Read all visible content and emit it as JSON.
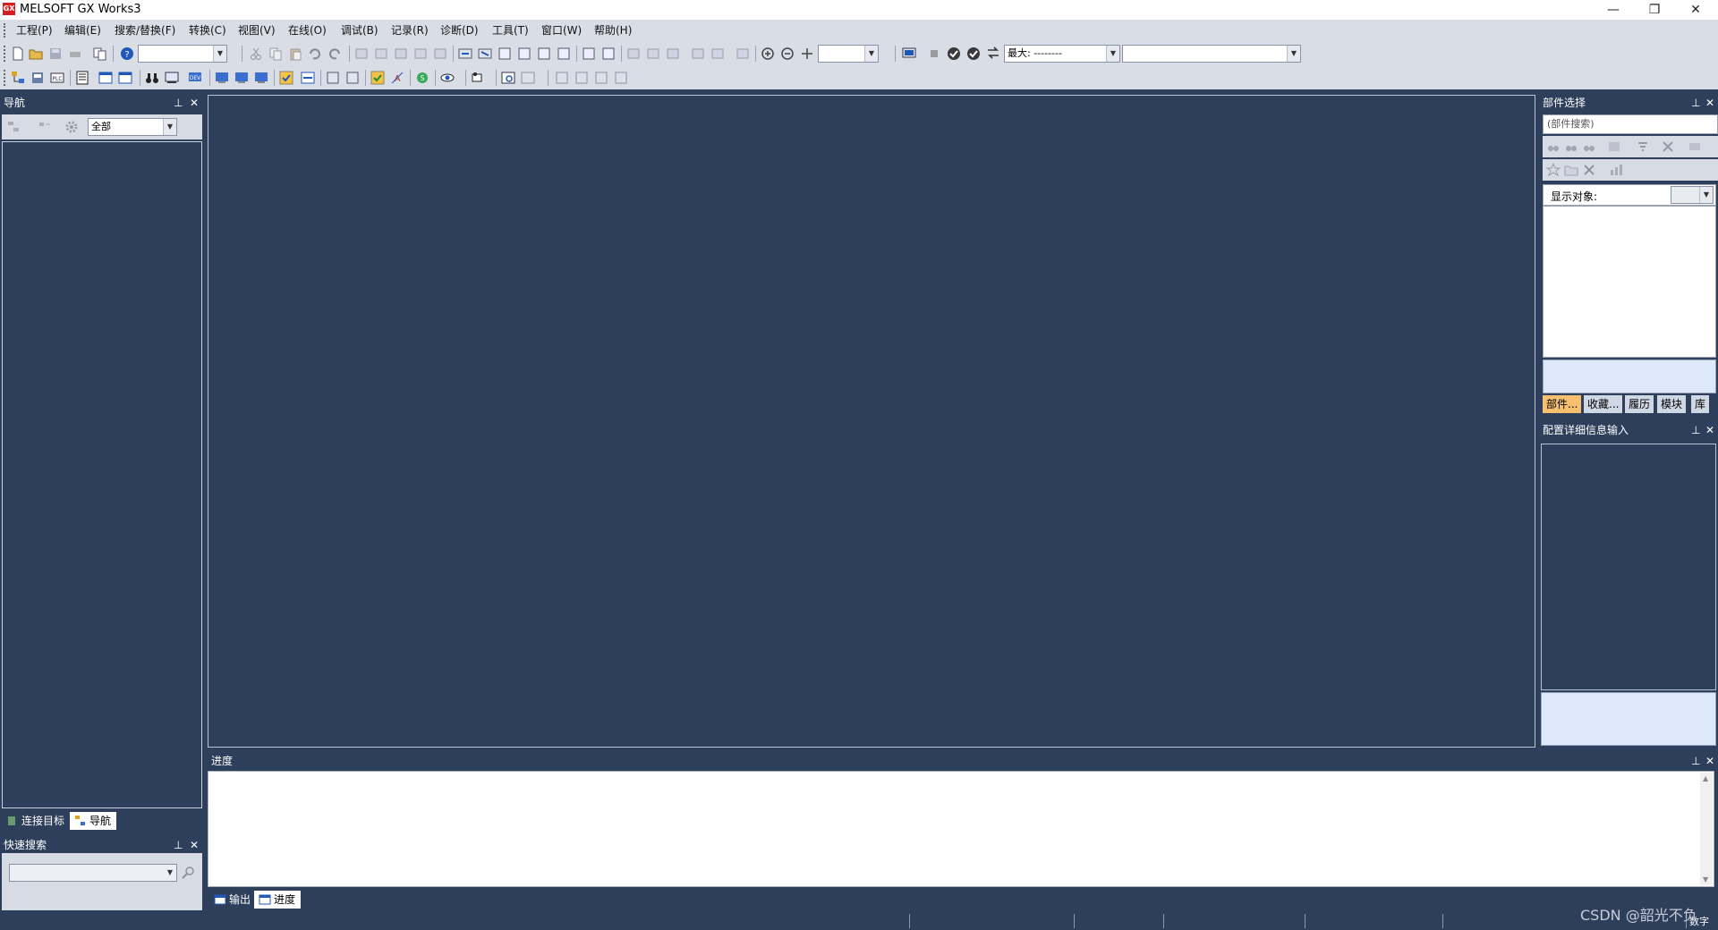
{
  "window": {
    "title": "MELSOFT GX Works3",
    "icon_text": "GX",
    "buttons": {
      "minimize": "—",
      "restore": "❐",
      "close": "✕"
    }
  },
  "menu": [
    {
      "label": "工程(P)"
    },
    {
      "label": "编辑(E)"
    },
    {
      "label": "搜索/替换(F)"
    },
    {
      "label": "转换(C)"
    },
    {
      "label": "视图(V)"
    },
    {
      "label": "在线(O)"
    },
    {
      "label": "调试(B)"
    },
    {
      "label": "记录(R)"
    },
    {
      "label": "诊断(D)"
    },
    {
      "label": "工具(T)"
    },
    {
      "label": "窗口(W)"
    },
    {
      "label": "帮助(H)"
    }
  ],
  "toolbar": {
    "project_combo_value": "",
    "zoom_combo_value": "",
    "max_label": "最大: --------",
    "right_combo_value": "",
    "colors": {
      "check": "#3a3a3a",
      "arrow_blue": "#2157b8",
      "icon_blue": "#3a6fd0",
      "icon_orange": "#e0a020"
    }
  },
  "navigation": {
    "title": "导航",
    "filter_value": "全部",
    "tabs": [
      {
        "label": "连接目标",
        "active": false
      },
      {
        "label": "导航",
        "active": true
      }
    ]
  },
  "quick_search": {
    "title": "快速搜索",
    "input_value": ""
  },
  "progress_panel": {
    "title": "进度",
    "tabs": [
      {
        "label": "输出",
        "active": false
      },
      {
        "label": "进度",
        "active": true
      }
    ]
  },
  "parts_panel": {
    "title": "部件选择",
    "search_placeholder": "(部件搜索)",
    "filter_label": "显示对象:",
    "filter_value": "",
    "tabs": [
      {
        "label": "部件...",
        "active": true
      },
      {
        "label": "收藏...",
        "active": false
      },
      {
        "label": "履历",
        "active": false
      },
      {
        "label": "模块",
        "active": false
      },
      {
        "label": "库",
        "active": false
      }
    ]
  },
  "config_panel": {
    "title": "配置详细信息输入"
  },
  "statusbar": {
    "num_lock": "数字"
  },
  "watermark": "CSDN @韶光不负"
}
